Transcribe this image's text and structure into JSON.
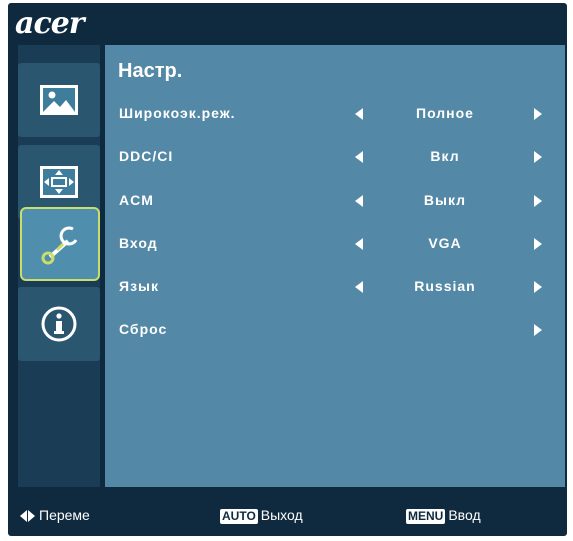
{
  "brand": {
    "logo_text": "acer"
  },
  "sidebar": {
    "tabs": [
      {
        "icon": "picture-icon",
        "active": false
      },
      {
        "icon": "position-icon",
        "active": false
      },
      {
        "icon": "wrench-setup-icon",
        "active": true
      },
      {
        "icon": "info-icon",
        "active": false
      }
    ]
  },
  "menu": {
    "title": "Настр.",
    "rows": [
      {
        "label": "Широкоэк.реж.",
        "value": "Полное"
      },
      {
        "label": "DDC/CI",
        "value": "Вкл"
      },
      {
        "label": "ACM",
        "value": "Выкл"
      },
      {
        "label": "Вход",
        "value": "VGA"
      },
      {
        "label": "Язык",
        "value": "Russian"
      },
      {
        "label": "Сброс",
        "value": ""
      }
    ]
  },
  "footer": {
    "navigate": "Переме",
    "auto_key": "AUTO",
    "auto_label": "Выход",
    "menu_key": "MENU",
    "menu_label": "Ввод"
  },
  "colors": {
    "osd_background": "#0f2a3e",
    "panel_background": "#5388a6",
    "active_tab_border": "#c9dd6a",
    "text": "#ffffff"
  }
}
